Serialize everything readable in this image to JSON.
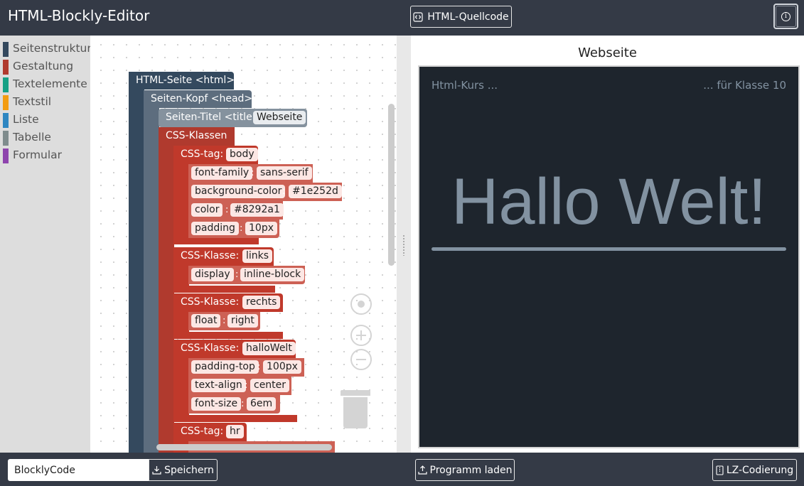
{
  "header": {
    "title": "HTML-Blockly-Editor",
    "source_button": "HTML-Quellcode",
    "info_icon": "info-icon"
  },
  "toolbox": {
    "items": [
      {
        "label": "Seitenstruktur",
        "color": "#34495e"
      },
      {
        "label": "Gestaltung",
        "color": "#b03a2e"
      },
      {
        "label": "Textelemente",
        "color": "#16a085"
      },
      {
        "label": "Textstil",
        "color": "#f39c12"
      },
      {
        "label": "Liste",
        "color": "#2e86c1"
      },
      {
        "label": "Tabelle",
        "color": "#7f8c8d"
      },
      {
        "label": "Formular",
        "color": "#8e44ad"
      }
    ]
  },
  "blocks": {
    "html_page": "HTML-Seite <html>",
    "head": "Seiten-Kopf <head>",
    "title_label": "Seiten-Titel <title>",
    "title_value": "Webseite",
    "css_classes": "CSS-Klassen",
    "css_tag_label": "CSS-tag:",
    "css_class_label": "CSS-Klasse:",
    "body_tag": "body",
    "body_rules": [
      {
        "prop": "font-family",
        "value": "sans-serif"
      },
      {
        "prop": "background-color",
        "value": "#1e252d"
      },
      {
        "prop": "color",
        "value": "#8292a1"
      },
      {
        "prop": "padding",
        "value": "10px"
      }
    ],
    "links_class": "links",
    "links_rules": [
      {
        "prop": "display",
        "value": "inline-block"
      }
    ],
    "rechts_class": "rechts",
    "rechts_rules": [
      {
        "prop": "float",
        "value": "right"
      }
    ],
    "hallo_class": "halloWelt",
    "hallo_rules": [
      {
        "prop": "padding-top",
        "value": "100px"
      },
      {
        "prop": "text-align",
        "value": "center"
      },
      {
        "prop": "font-size",
        "value": "6em"
      }
    ],
    "hr_tag": "hr"
  },
  "preview": {
    "title": "Webseite",
    "left_text": "Html-Kurs ...",
    "right_text": "... für Klasse 10",
    "heading": "Hallo Welt!",
    "bg_color": "#1e252d",
    "text_color": "#8292a1"
  },
  "footer": {
    "filename": "BlocklyCode",
    "save_button": "Speichern",
    "load_button": "Programm laden",
    "lz_button": "LZ-Codierung"
  }
}
